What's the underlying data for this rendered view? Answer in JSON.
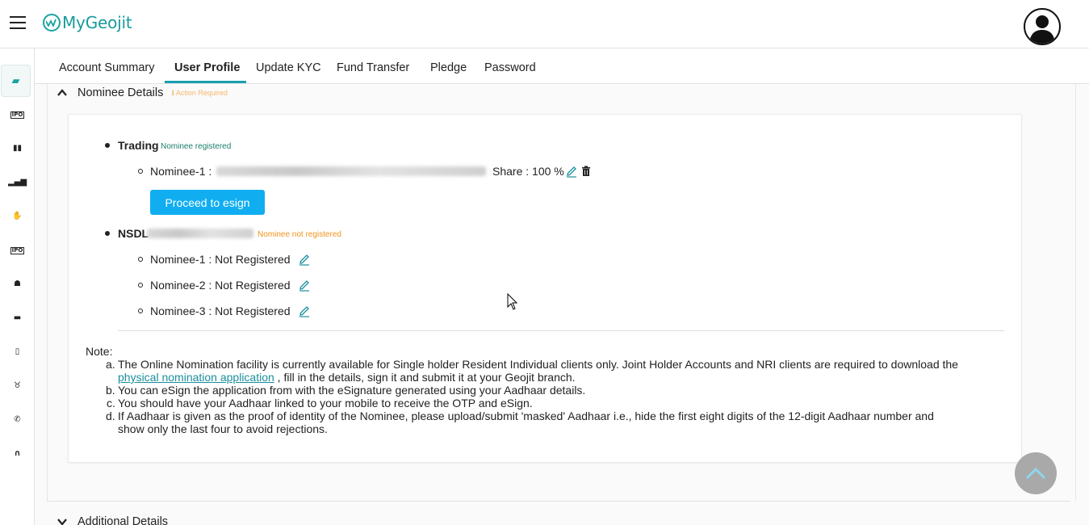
{
  "header": {
    "logo_text": "MyGeojit"
  },
  "nav_rail": {
    "items": [
      "wallet-icon",
      "ipo-icon",
      "book-icon",
      "chart-icon",
      "handshake-icon",
      "ipo-icon",
      "network-icon",
      "car-icon",
      "document-icon",
      "bull-icon",
      "phone-icon",
      "headset-icon"
    ],
    "labels": [
      "IPO",
      "IPO"
    ]
  },
  "tabs": [
    {
      "label": "Account Summary"
    },
    {
      "label": "User Profile"
    },
    {
      "label": "Update KYC"
    },
    {
      "label": "Fund Transfer"
    },
    {
      "label": "Pledge"
    },
    {
      "label": "Password"
    }
  ],
  "nominee_section": {
    "title": "Nominee Details",
    "action_required": "ℹ Action Required",
    "trading": {
      "label": "Trading",
      "status": "Nominee registered",
      "nominee_label": "Nominee-1 :",
      "share": "Share : 100 %",
      "esign_button": "Proceed to esign"
    },
    "nsdl": {
      "label": "NSDL",
      "status": "Nominee not registered",
      "nominees": [
        "Nominee-1 : Not Registered",
        "Nominee-2 : Not Registered",
        "Nominee-3 : Not Registered"
      ]
    },
    "note": {
      "label": "Note:",
      "items": [
        {
          "marker": "a.",
          "line1": "The Online Nomination facility is currently available for Single holder Resident Individual clients only. Joint Holder Accounts and NRI clients are required to download the",
          "link": "physical nomination application",
          "line2_rest": " , fill in the details, sign it and submit it at your Geojit branch."
        },
        {
          "marker": "b.",
          "text": "You can eSign the application from with the eSignature generated using your Aadhaar details."
        },
        {
          "marker": "c.",
          "text": "You should have your Aadhaar linked to your mobile to receive the OTP and eSign."
        },
        {
          "marker": "d.",
          "line1": "If Aadhaar is given as the proof of identity of the Nominee, please upload/submit 'masked' Aadhaar i.e., hide the first eight digits of the 12-digit Aadhaar number and",
          "line2": "show only the last four to avoid rejections."
        }
      ]
    }
  },
  "additional_section": {
    "title": "Additional Details"
  },
  "colors": {
    "accent": "#1aa3a3",
    "button": "#10aef0",
    "registered": "#1a7d6a",
    "not_registered": "#f0941e"
  }
}
